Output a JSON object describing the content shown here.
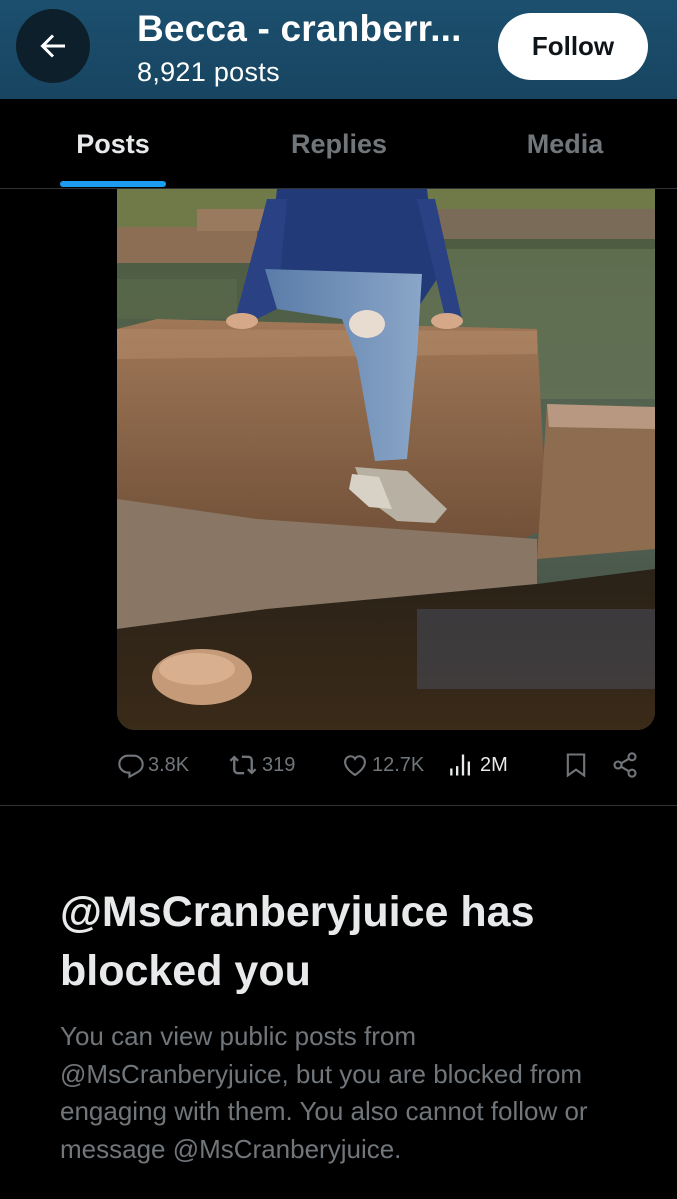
{
  "header": {
    "title": "Becca - cranberr...",
    "post_count": "8,921 posts",
    "follow_label": "Follow",
    "back_icon": "arrow-left-icon",
    "background_color": "#1c4f6e"
  },
  "tabs": [
    {
      "label": "Posts",
      "active": true
    },
    {
      "label": "Replies",
      "active": false
    },
    {
      "label": "Media",
      "active": false
    }
  ],
  "accent_color": "#1d9bf0",
  "post": {
    "image_icon": "post-photo",
    "stats": {
      "replies": "3.8K",
      "reposts": "319",
      "likes": "12.7K",
      "views": "2M"
    },
    "action_icons": [
      "reply-icon",
      "repost-icon",
      "like-icon",
      "views-icon",
      "bookmark-icon",
      "share-icon"
    ]
  },
  "blocked": {
    "title": "@MsCranberyjuice has blocked you",
    "body": "You can view public posts from @MsCranberyjuice, but you are blocked from engaging with them. You also cannot follow or message @MsCranberyjuice."
  }
}
